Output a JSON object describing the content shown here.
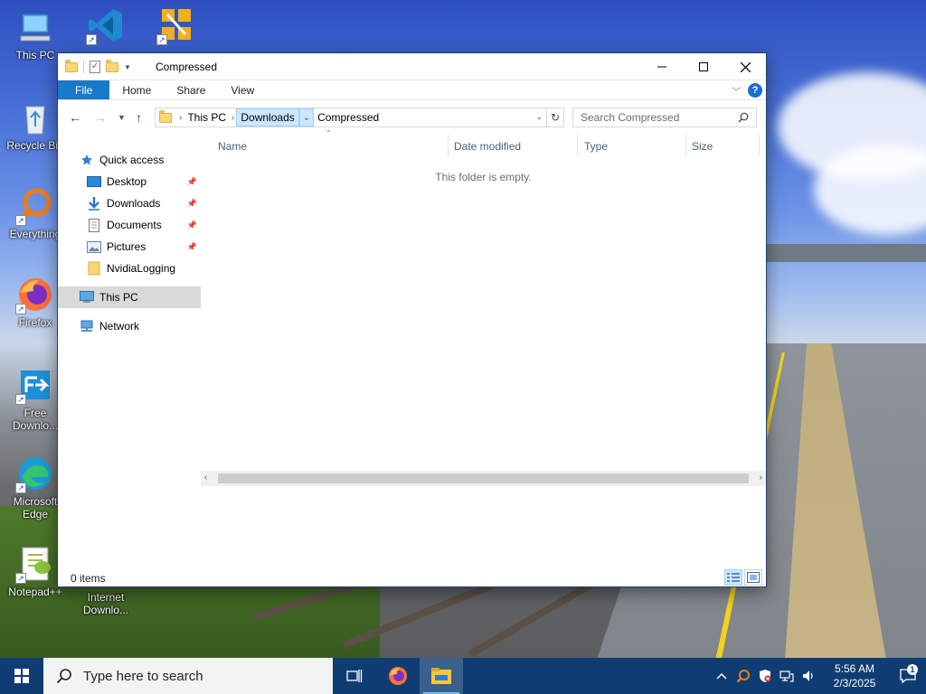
{
  "desktop": {
    "icons": [
      {
        "label": "This PC"
      },
      {
        "label": ""
      },
      {
        "label": ""
      },
      {
        "label": "Recycle Bin"
      },
      {
        "label": "Everything"
      },
      {
        "label": "Firefox"
      },
      {
        "label": "Free Downlo..."
      },
      {
        "label": "Microsoft Edge"
      },
      {
        "label": "Notepad++"
      },
      {
        "label": "Internet Downlo..."
      }
    ]
  },
  "window": {
    "title": "Compressed",
    "ribbon_tabs": [
      "File",
      "Home",
      "Share",
      "View"
    ],
    "breadcrumb": [
      "This PC",
      "Downloads",
      "Compressed"
    ],
    "search_placeholder": "Search Compressed",
    "nav": {
      "quick_access": "Quick access",
      "items": [
        "Desktop",
        "Downloads",
        "Documents",
        "Pictures",
        "NvidiaLogging"
      ],
      "this_pc": "This PC",
      "network": "Network"
    },
    "columns": [
      "Name",
      "Date modified",
      "Type",
      "Size"
    ],
    "empty_message": "This folder is empty.",
    "status": "0 items"
  },
  "taskbar": {
    "search_placeholder": "Type here to search",
    "time": "5:56 AM",
    "date": "2/3/2025",
    "notification_count": "1"
  },
  "colors": {
    "taskbar": "#0f3d73",
    "file_tab": "#1979ca",
    "selection": "#cce8ff"
  }
}
